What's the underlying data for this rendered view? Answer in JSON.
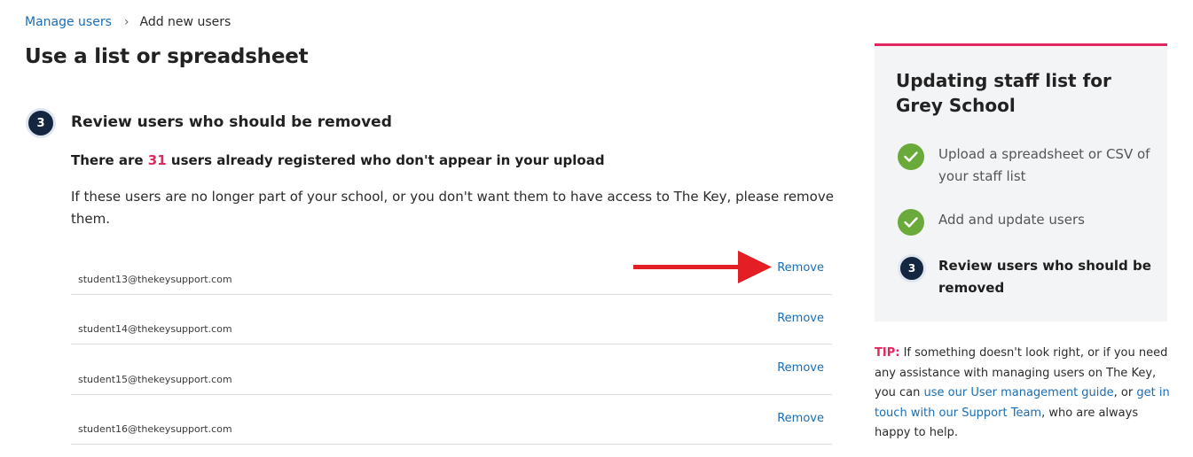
{
  "breadcrumb": {
    "parent": "Manage users",
    "separator": "›",
    "current": "Add new users"
  },
  "page_title": "Use a list or spreadsheet",
  "step": {
    "number": "3",
    "heading": "Review users who should be removed"
  },
  "summary": {
    "prefix": "There are ",
    "count": "31",
    "suffix": " users already registered who don't appear in your upload"
  },
  "description": "If these users are no longer part of your school, or you don't want them to have access to The Key, please remove them.",
  "users": [
    {
      "email": "student13@thekeysupport.com",
      "action": "Remove"
    },
    {
      "email": "student14@thekeysupport.com",
      "action": "Remove"
    },
    {
      "email": "student15@thekeysupport.com",
      "action": "Remove"
    },
    {
      "email": "student16@thekeysupport.com",
      "action": "Remove"
    }
  ],
  "sidebar": {
    "title": "Updating staff list for Grey School",
    "steps": [
      {
        "label": "Upload a spreadsheet or CSV of your staff list",
        "status": "complete"
      },
      {
        "label": "Add and update users",
        "status": "complete"
      },
      {
        "number": "3",
        "label": "Review users who should be removed",
        "status": "current"
      }
    ]
  },
  "tip": {
    "label": "TIP:",
    "text1": " If something doesn't look right, or if you need any assistance with managing users on The Key, you can ",
    "link1": "use our User management guide",
    "text2": ", or ",
    "link2": "get in touch with our Support Team",
    "text3": ", who are always happy to help."
  },
  "colors": {
    "accent_pink": "#e0285e",
    "link_blue": "#1a6db3",
    "navy": "#142640",
    "check_green": "#6aaa3a",
    "annotation_arrow": "#e31e24"
  }
}
